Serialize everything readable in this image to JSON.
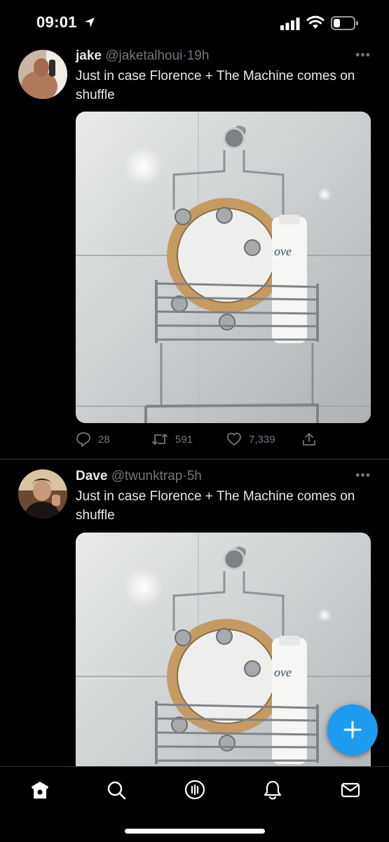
{
  "status_bar": {
    "time": "09:01",
    "icons": [
      "location-arrow-icon",
      "cellular-signal-icon",
      "wifi-icon",
      "battery-low-icon"
    ]
  },
  "tweets": [
    {
      "name": "jake",
      "handle": "@jaketalhoui",
      "separator": "·",
      "time": "19h",
      "text": "Just in case Florence + The Machine comes on shuffle",
      "media_description": "photo of a tambourine placed in a shower caddy next to a Dove bottle",
      "replies": "28",
      "retweets": "591",
      "likes": "7,339"
    },
    {
      "name": "Dave",
      "handle": "@twunktrap",
      "separator": "·",
      "time": "5h",
      "text": "Just in case Florence + The Machine comes on shuffle",
      "media_description": "photo of a tambourine placed in a shower caddy next to a Dove bottle"
    }
  ],
  "more_label": "•••",
  "media_bottle_label": "ove",
  "fab": {
    "icon": "plus-icon",
    "color": "#1d9bf0"
  },
  "tab_bar": {
    "items": [
      "home-icon",
      "search-icon",
      "spaces-icon",
      "notifications-icon",
      "messages-icon"
    ]
  },
  "colors": {
    "background": "#000000",
    "text": "#e7e9ea",
    "muted": "#71767b",
    "accent": "#1d9bf0",
    "divider": "#2f3336"
  }
}
